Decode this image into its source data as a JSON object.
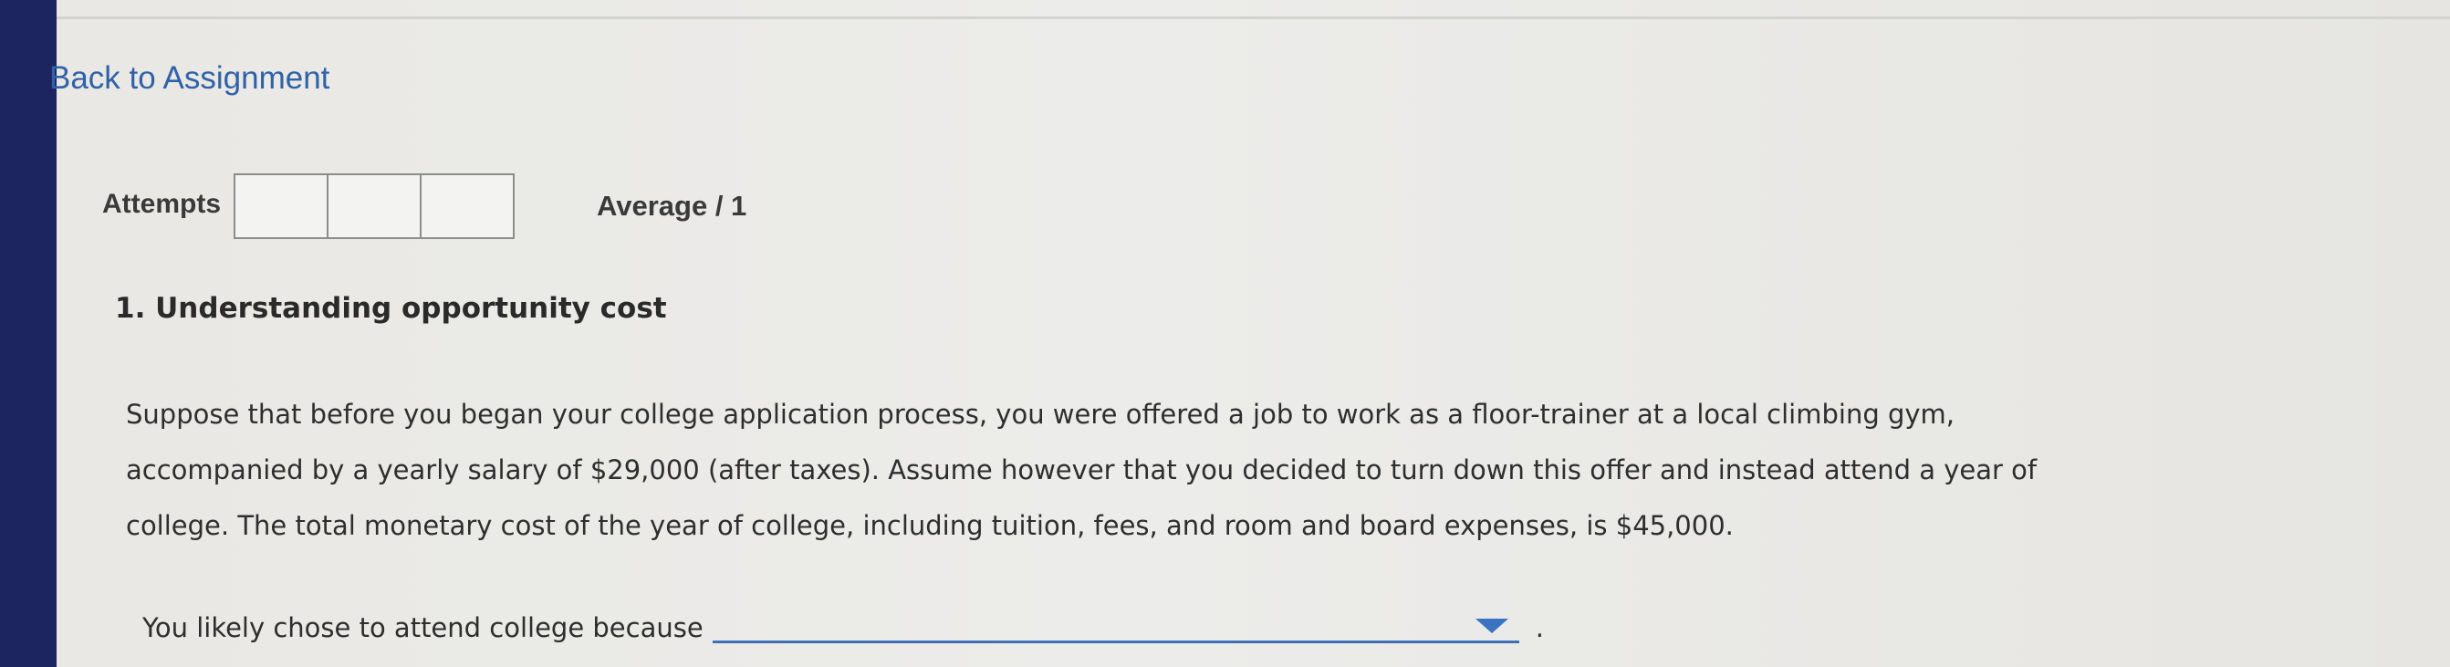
{
  "nav": {
    "back_label": "Back to Assignment"
  },
  "attempts": {
    "label": "Attempts",
    "boxes": 3,
    "average_label": "Average / 1"
  },
  "question": {
    "title": "1. Understanding opportunity cost",
    "body_lines": [
      "Suppose that before you began your college application process, you were offered a job to work as a floor-trainer at a local climbing gym,",
      "accompanied by a yearly salary of $29,000 (after taxes). Assume however that you decided to turn down this offer and instead attend a year of",
      "college. The total monetary cost of the year of college, including tuition, fees, and room and board expenses, is $45,000."
    ],
    "prompt": "You likely chose to attend college because",
    "dropdown_value": "",
    "suffix": "."
  },
  "colors": {
    "link": "#2f62a8",
    "sidebar": "#1d2560",
    "dropdown_accent": "#3a73c2"
  }
}
